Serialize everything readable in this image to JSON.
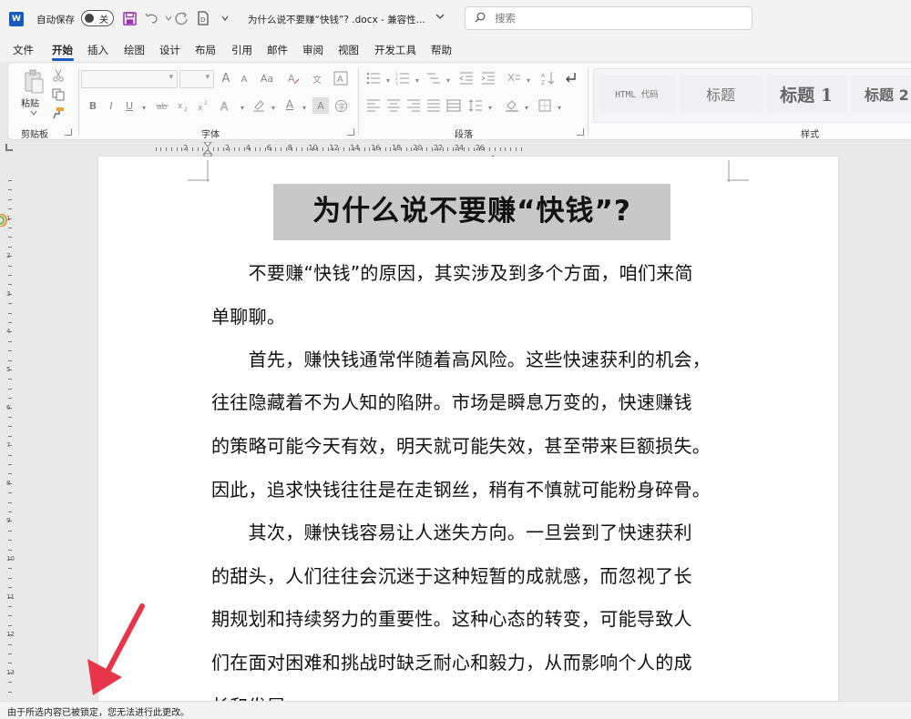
{
  "titlebar": {
    "app_icon_letter": "W",
    "autosave_label": "自动保存",
    "autosave_state": "关",
    "doc_title": "为什么说不要赚“快钱”? .docx  -  兼容性...",
    "search_placeholder": "搜索"
  },
  "menu": {
    "tabs": [
      "文件",
      "开始",
      "插入",
      "绘图",
      "设计",
      "布局",
      "引用",
      "邮件",
      "审阅",
      "视图",
      "开发工具",
      "帮助"
    ],
    "active": "开始"
  },
  "ribbon": {
    "clipboard": {
      "paste_label": "粘贴",
      "group_label": "剪贴板"
    },
    "font": {
      "group_label": "字体",
      "bold": "B",
      "italic": "I",
      "underline": "U",
      "grow": "A",
      "shrink": "A",
      "case": "Aa",
      "font_color": "A",
      "char_shade": "A"
    },
    "paragraph": {
      "group_label": "段落"
    },
    "styles": {
      "group_label": "样式",
      "tiles": [
        "HTML 代码",
        "标题",
        "标题 1",
        "标题 2"
      ]
    }
  },
  "ruler": {
    "numbers": [
      "2",
      "4",
      "6",
      "8",
      "10",
      "12",
      "14",
      "16",
      "18",
      "20",
      "22",
      "24",
      "26"
    ],
    "left_numbers": [
      "2"
    ],
    "vertical_numbers": [
      "1",
      "2",
      "3",
      "4",
      "5",
      "6",
      "7",
      "8",
      "9",
      "10",
      "11",
      "12",
      "13",
      "14"
    ]
  },
  "document": {
    "heading": "为什么说不要赚“快钱”?",
    "lines": [
      "　　不要赚“快钱”的原因，其实涉及到多个方面，咱们来简",
      "单聊聊。",
      "　　首先，赚快钱通常伴随着高风险。这些快速获利的机会，",
      "往往隐藏着不为人知的陷阱。市场是瞬息万变的，快速赚钱",
      "的策略可能今天有效，明天就可能失效，甚至带来巨额损失。",
      "因此，追求快钱往往是在走钢丝，稍有不慎就可能粉身碎骨。",
      "　　其次，赚快钱容易让人迷失方向。一旦尝到了快速获利",
      "的甜头，人们往往会沉迷于这种短暂的成就感，而忽视了长",
      "期规划和持续努力的重要性。这种心态的转变，可能导致人",
      "们在面对困难和挑战时缺乏耐心和毅力，从而影响个人的成",
      "长和发展。"
    ]
  },
  "statusbar": {
    "message": "由于所选内容已被锁定，您无法进行此更改。"
  },
  "colors": {
    "accent": "#185abd",
    "arrow": "#e8354a",
    "heading_highlight": "#c8c8c8"
  }
}
